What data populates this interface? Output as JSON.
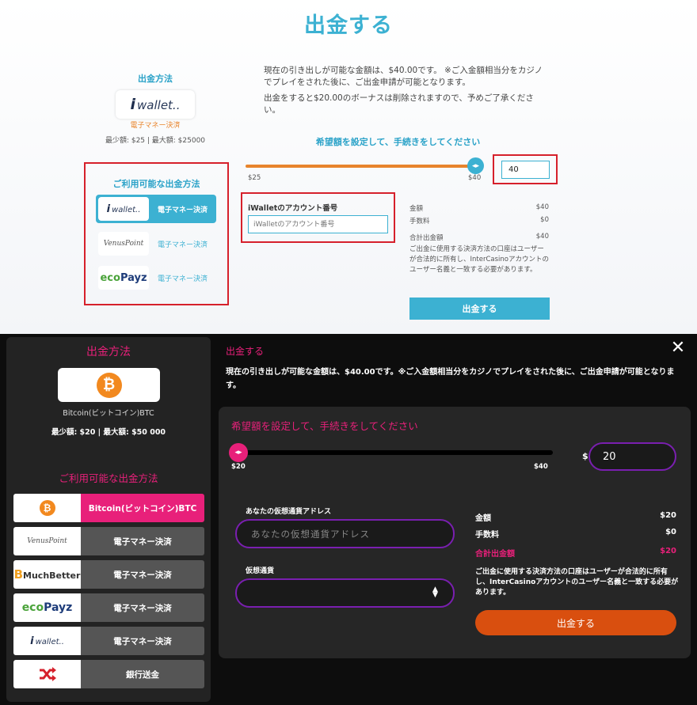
{
  "top": {
    "title": "出金する",
    "method_heading": "出金方法",
    "selected_method": {
      "logo": "wallet..",
      "type": "電子マネー決済",
      "limits": "最少額: $25 | 最大額: $25000"
    },
    "available_heading": "ご利用可能な出金方法",
    "options": [
      {
        "logo": "wallet..",
        "label": "電子マネー決済"
      },
      {
        "logo": "VenusPoint",
        "label": "電子マネー決済"
      },
      {
        "logo_a": "eco",
        "logo_b": "Payz",
        "label": "電子マネー決済"
      }
    ],
    "info_line1": "現在の引き出しが可能な金額は、$40.00です。 ※ご入金額相当分をカジノでプレイをされた後に、ご出金申請が可能となります。",
    "info_line2": "出金をすると$20.00のボーナスは削除されますので、予めご了承ください。",
    "set_heading": "希望額を設定して、手続きをしてください",
    "slider": {
      "min_label": "$25",
      "max_label": "$40",
      "value": 40,
      "min": 25,
      "max": 40
    },
    "amount_value": "40",
    "account_label": "iWalletのアカウント番号",
    "account_placeholder": "iWalletのアカウント番号",
    "summary": {
      "amount_label": "金額",
      "amount": "$40",
      "fee_label": "手数料",
      "fee": "$0",
      "total_label": "合計出金額",
      "total": "$40"
    },
    "note": "ご出金に使用する決済方法の口座はユーザーが合法的に所有し、InterCasinoアカウントのユーザー名義と一致する必要があります。",
    "submit_label": "出金する"
  },
  "bottom": {
    "method_heading": "出金方法",
    "selected_method": {
      "logo": "₿",
      "name": "Bitcoin(ビットコイン)BTC",
      "limits": "最少額: $20 | 最大額: $50 000"
    },
    "available_heading": "ご利用可能な出金方法",
    "options": [
      {
        "logo": "₿",
        "label": "Bitcoin(ビットコイン)BTC"
      },
      {
        "logo": "VenusPoint",
        "label": "電子マネー決済"
      },
      {
        "logo_a": "B",
        "logo_b": "MuchBetter",
        "label": "電子マネー決済"
      },
      {
        "logo_a": "eco",
        "logo_b": "Payz",
        "label": "電子マネー決済"
      },
      {
        "logo": "wallet..",
        "label": "電子マネー決済"
      },
      {
        "logo": "shuffle-icon",
        "label": "銀行送金"
      }
    ],
    "title": "出金する",
    "close": "✕",
    "info": "現在の引き出しが可能な金額は、$40.00です。※ご入金額相当分をカジノでプレイをされた後に、ご出金申請が可能となります。",
    "set_heading": "希望額を設定して、手続きをしてください",
    "slider": {
      "min_label": "$20",
      "max_label": "$40",
      "value": 20,
      "min": 20,
      "max": 40
    },
    "currency_symbol": "$",
    "amount_value": "20",
    "address_label": "あなたの仮想通貨アドレス",
    "address_placeholder": "あなたの仮想通貨アドレス",
    "crypto_label": "仮想通貨",
    "summary": {
      "amount_label": "金額",
      "amount": "$20",
      "fee_label": "手数料",
      "fee": "$0",
      "total_label": "合計出金額",
      "total": "$20"
    },
    "note": "ご出金に使用する決済方法の口座はユーザーが合法的に所有し、InterCasinoアカウントのユーザー名義と一致する必要があります。",
    "submit_label": "出金する"
  },
  "colors": {
    "top_accent": "#3cb1d2",
    "slider_orange": "#e8842c",
    "dark_pink": "#e8207a",
    "dark_purple": "#7a1fb0",
    "dark_submit": "#d94f0f",
    "highlight_red": "#d6202b"
  }
}
